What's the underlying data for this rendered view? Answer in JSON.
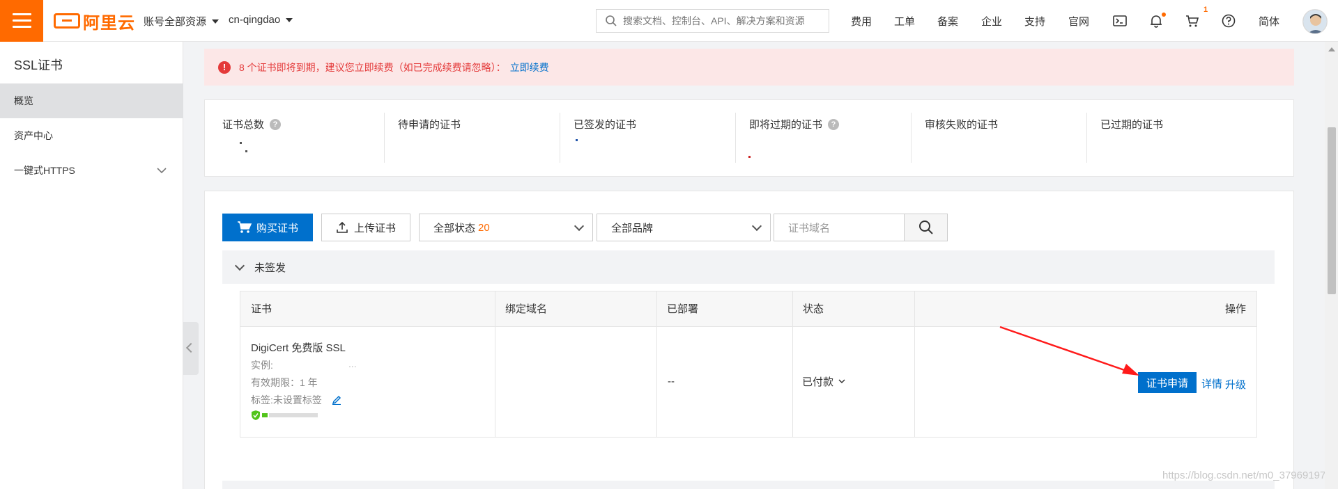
{
  "topbar": {
    "logo_text": "阿里云",
    "account_menu": "账号全部资源",
    "region": "cn-qingdao",
    "search_placeholder": "搜索文档、控制台、API、解决方案和资源",
    "nav": [
      "费用",
      "工单",
      "备案",
      "企业",
      "支持",
      "官网"
    ],
    "cart_badge": "1",
    "language": "简体"
  },
  "sidebar": {
    "title": "SSL证书",
    "items": [
      {
        "label": "概览",
        "active": true
      },
      {
        "label": "资产中心"
      },
      {
        "label": "一键式HTTPS"
      }
    ]
  },
  "alert": {
    "message": "8 个证书即将到期，建议您立即续费（如已完成续费请忽略）：",
    "link": "立即续费"
  },
  "stats": [
    {
      "label": "证书总数",
      "help": true
    },
    {
      "label": "待申请的证书"
    },
    {
      "label": "已签发的证书"
    },
    {
      "label": "即将过期的证书",
      "help": true
    },
    {
      "label": "审核失败的证书"
    },
    {
      "label": "已过期的证书"
    }
  ],
  "toolbar": {
    "buy_label": "购买证书",
    "upload_label": "上传证书",
    "status_filter": "全部状态",
    "status_count": "20",
    "brand_filter": "全部品牌",
    "domain_placeholder": "证书域名"
  },
  "group": {
    "title": "未签发"
  },
  "table": {
    "headers": [
      "证书",
      "绑定域名",
      "已部署",
      "状态",
      "操作"
    ],
    "rows": [
      {
        "cert_name": "DigiCert 免费版 SSL",
        "instance": "实例:",
        "instance_tail": "...",
        "validity": "有效期限：1 年",
        "tags": "标签:未设置标签",
        "domain": "",
        "deployed": "--",
        "status": "已付款",
        "actions": {
          "apply": "证书申请",
          "detail": "详情",
          "upgrade": "升级"
        }
      }
    ]
  },
  "watermark": "https://blog.csdn.net/m0_37969197",
  "colors": {
    "brand": "#ff6a00",
    "primary": "#0070cc",
    "alert_bg": "#fce7e7",
    "alert_text": "#e43a3a",
    "annotation_arrow": "#ff0000"
  }
}
